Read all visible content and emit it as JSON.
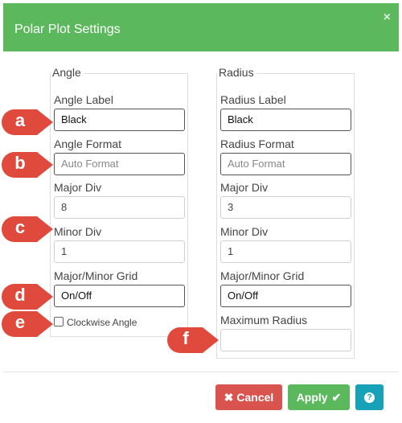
{
  "dialog": {
    "title": "Polar Plot Settings",
    "close_symbol": "×",
    "header_color": "#5cb85c"
  },
  "angle": {
    "legend": "Angle",
    "label_label": "Angle Label",
    "label_value": "Black",
    "format_label": "Angle Format",
    "format_placeholder": "Auto Format",
    "major_div_label": "Major Div",
    "major_div_value": "8",
    "minor_div_label": "Minor Div",
    "minor_div_value": "1",
    "grid_label": "Major/Minor Grid",
    "grid_value": "On/Off",
    "clockwise_label": "Clockwise Angle",
    "clockwise_checked": false
  },
  "radius": {
    "legend": "Radius",
    "label_label": "Radius Label",
    "label_value": "Black",
    "format_label": "Radius Format",
    "format_placeholder": "Auto Format",
    "major_div_label": "Major Div",
    "major_div_value": "3",
    "minor_div_label": "Minor Div",
    "minor_div_value": "1",
    "grid_label": "Major/Minor Grid",
    "grid_value": "On/Off",
    "max_radius_label": "Maximum Radius",
    "max_radius_value": ""
  },
  "buttons": {
    "cancel": "Cancel",
    "apply": "Apply",
    "cancel_icon": "x-icon",
    "apply_icon": "check-icon",
    "help_icon": "question-circle-icon"
  },
  "markers": [
    "a",
    "b",
    "c",
    "d",
    "e",
    "f"
  ],
  "colors": {
    "cancel": "#d9534f",
    "apply": "#5cb85c",
    "help": "#17a2b8",
    "marker": "#e04a3c"
  }
}
